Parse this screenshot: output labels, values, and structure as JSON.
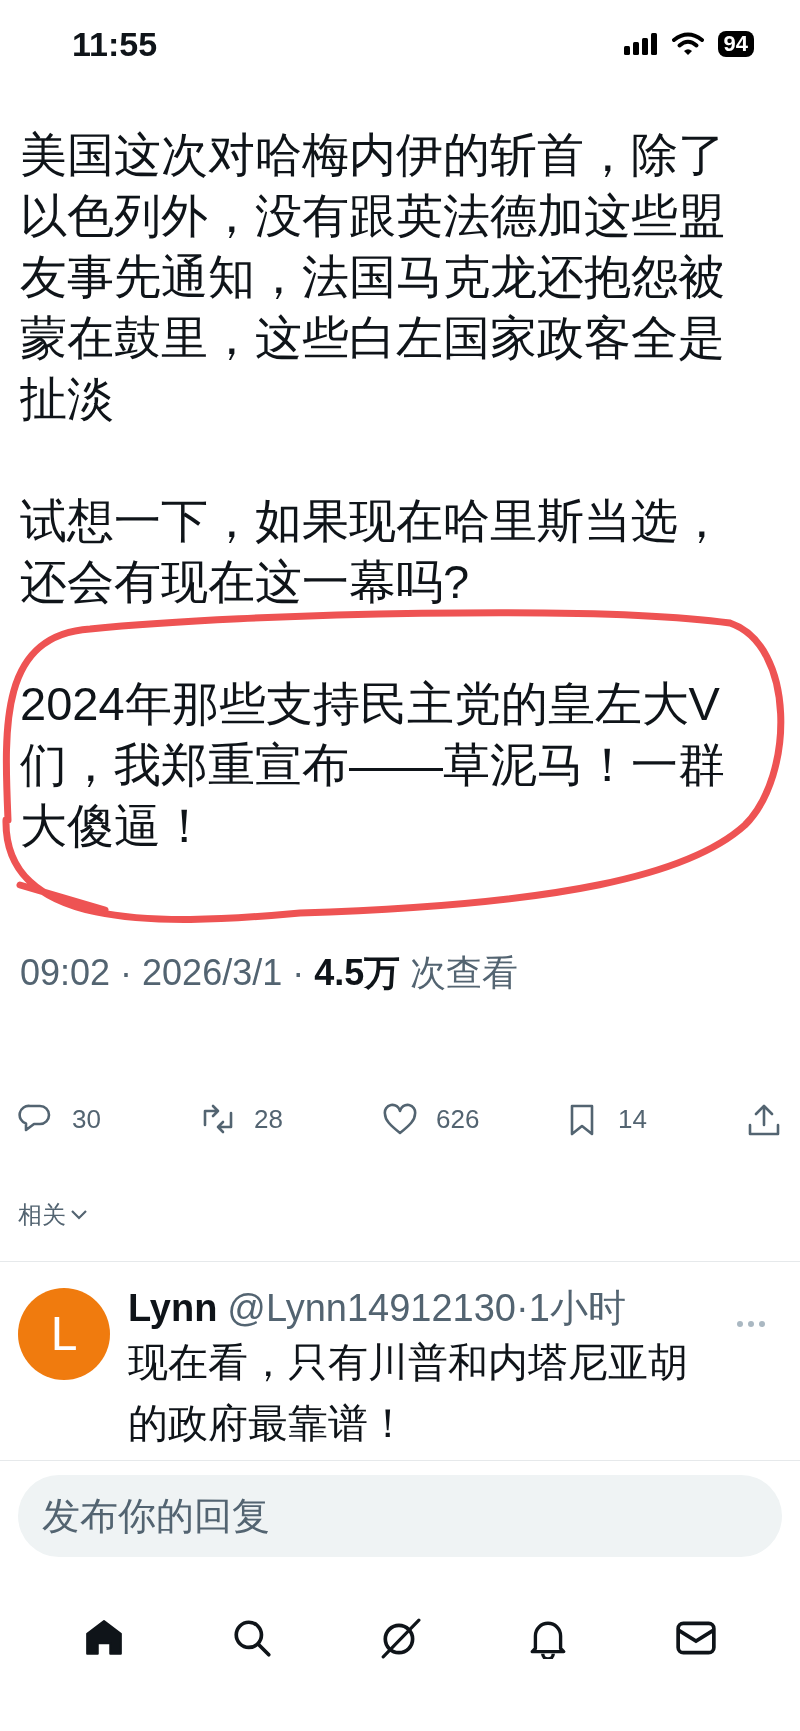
{
  "status_bar": {
    "time": "11:55",
    "battery": "94"
  },
  "post": {
    "paragraphs": [
      "美国这次对哈梅内伊的斩首，除了以色列外，没有跟英法德加这些盟友事先通知，法国马克龙还抱怨被蒙在鼓里，这些白左国家政客全是扯淡",
      "试想一下，如果现在哈里斯当选，还会有现在这一幕吗?",
      "2024年那些支持民主党的皇左大V们，我郑重宣布——草泥马！一群大傻逼！"
    ],
    "meta": "09:02 · 2026/3/1 · **4.5万** 次查看",
    "actions": [
      {
        "kind": "reply",
        "count": "30"
      },
      {
        "kind": "repost",
        "count": "28"
      },
      {
        "kind": "like",
        "count": "626"
      },
      {
        "kind": "bookmark",
        "count": "14"
      },
      {
        "kind": "share"
      }
    ]
  },
  "related": {
    "label": "相关"
  },
  "replies": [
    {
      "avatar": "L",
      "name": "Lynn",
      "handle": "@Lynn14912130",
      "time": "·1小时",
      "text": "现在看，只有川普和内塔尼亚胡的政府最靠谱！"
    }
  ],
  "reply_box": {
    "placeholder": "发布你的回复"
  },
  "nav": [
    {
      "kind": "home",
      "selected": true
    },
    {
      "kind": "search",
      "selected": false
    },
    {
      "kind": "grok",
      "selected": false
    },
    {
      "kind": "notifications",
      "selected": false
    },
    {
      "kind": "messages",
      "selected": false
    }
  ]
}
